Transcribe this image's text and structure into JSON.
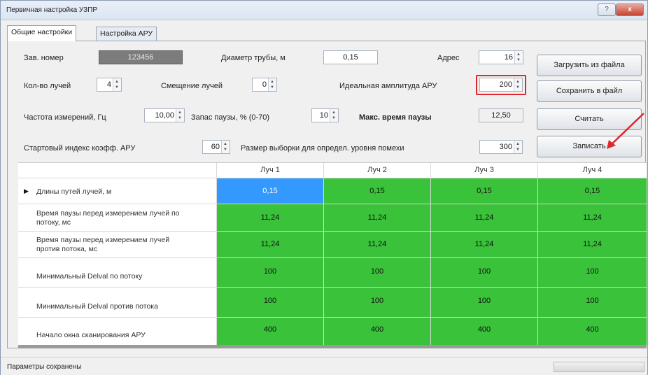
{
  "window": {
    "title": "Первичная настройка УЗПР",
    "help_label": "?",
    "close_label": "x"
  },
  "tabs": [
    {
      "label": "Общие настройки",
      "active": true
    },
    {
      "label": "Настройка АРУ",
      "active": false
    }
  ],
  "fields": {
    "serial": {
      "label": "Зав. номер",
      "value": "123456"
    },
    "diameter": {
      "label": "Диаметр трубы, м",
      "value": "0,15"
    },
    "address": {
      "label": "Адрес",
      "value": "16"
    },
    "beams": {
      "label": "Кол-во лучей",
      "value": "4"
    },
    "offset": {
      "label": "Смещение лучей",
      "value": "0"
    },
    "ideal_amp": {
      "label": "Идеальная амплитуда АРУ",
      "value": "200"
    },
    "freq": {
      "label": "Частота измерений, Гц",
      "value": "10,00"
    },
    "pause_reserve": {
      "label": "Запас паузы, % (0-70)",
      "value": "10"
    },
    "max_pause": {
      "label": "Макс. время паузы",
      "value": "12,50"
    },
    "start_index": {
      "label": "Стартовый индекс коэфф. АРУ",
      "value": "60"
    },
    "sample_size": {
      "label": "Размер выборки для определ. уровня помехи",
      "value": "300"
    }
  },
  "buttons": {
    "load": "Загрузить из файла",
    "save": "Сохранить в файл",
    "read": "Считать",
    "write": "Записать"
  },
  "grid": {
    "columns": [
      "Луч 1",
      "Луч 2",
      "Луч 3",
      "Луч 4"
    ],
    "rows": [
      {
        "label": "Длины путей лучей, м",
        "values": [
          "0,15",
          "0,15",
          "0,15",
          "0,15"
        ]
      },
      {
        "label": "Время паузы перед измерением лучей по потоку, мс",
        "values": [
          "11,24",
          "11,24",
          "11,24",
          "11,24"
        ]
      },
      {
        "label": "Время паузы перед измерением лучей против потока, мс",
        "values": [
          "11,24",
          "11,24",
          "11,24",
          "11,24"
        ]
      },
      {
        "label": "Минимальный Delval по потоку",
        "values": [
          "100",
          "100",
          "100",
          "100"
        ]
      },
      {
        "label": "Минимальный Delval против потока",
        "values": [
          "100",
          "100",
          "100",
          "100"
        ]
      },
      {
        "label": "Начало окна сканирования АРУ",
        "values": [
          "400",
          "400",
          "400",
          "400"
        ]
      }
    ],
    "colors": {
      "cell": "#3ac23a",
      "selected": "#3399ff"
    }
  },
  "status": {
    "text": "Параметры сохранены"
  },
  "annotations": {
    "highlight_color": "#e0262f",
    "arrow_color": "#e0262f"
  }
}
